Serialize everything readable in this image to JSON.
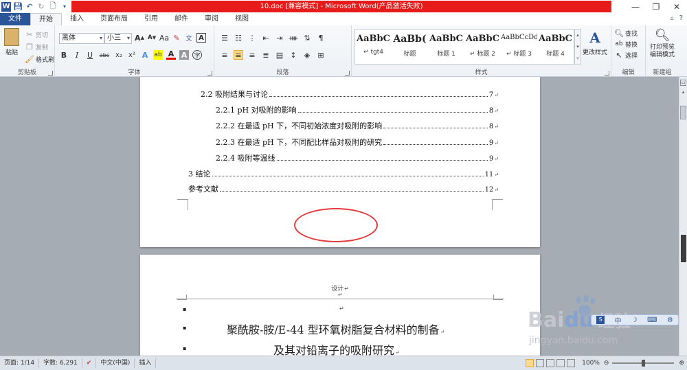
{
  "app": {
    "title": "10.doc [兼容模式] - Microsoft Word(产品激活失败)",
    "accent": "#2a5699",
    "title_bar_color": "#e81b1b"
  },
  "qat": {
    "icons": [
      "word-logo-icon",
      "save-icon",
      "undo-icon",
      "redo-icon",
      "print-preview-icon",
      "customize-qat-icon"
    ]
  },
  "window_controls": {
    "icons": [
      "minimize-icon",
      "restore-icon",
      "close-icon"
    ],
    "glyphs": [
      "—",
      "❐",
      "✕"
    ]
  },
  "tabs": [
    {
      "label": "文件"
    },
    {
      "label": "开始"
    },
    {
      "label": "插入"
    },
    {
      "label": "页面布局"
    },
    {
      "label": "引用"
    },
    {
      "label": "邮件"
    },
    {
      "label": "审阅"
    },
    {
      "label": "视图"
    }
  ],
  "ribbon": {
    "clipboard": {
      "label": "剪贴板",
      "paste": "粘贴",
      "cut": "剪切",
      "copy": "复制",
      "format_painter": "格式刷"
    },
    "font": {
      "label": "字体",
      "font_name": "黑体",
      "font_size": "小三",
      "bold": "B",
      "italic": "I",
      "underline": "U",
      "strike": "abc",
      "subscript": "x₂",
      "superscript": "x²",
      "grow": "A",
      "shrink": "A",
      "change_case": "Aa",
      "clear": "A",
      "phonetic": "wén",
      "char_border": "A",
      "highlight": "ab",
      "font_color": "A",
      "char_shading": "A",
      "enclosed": "字"
    },
    "paragraph": {
      "label": "段落"
    },
    "styles": {
      "label": "样式",
      "items": [
        {
          "sample": "AaBbC",
          "name": "↵ tgt4"
        },
        {
          "sample": "AaBb(",
          "name": "标题"
        },
        {
          "sample": "AaBbC",
          "name": "标题 1"
        },
        {
          "sample": "AaBbC",
          "name": "↵ 标题 2"
        },
        {
          "sample": "AaBbCcDd",
          "name": "↵ 标题 3"
        },
        {
          "sample": "AaBbC",
          "name": "标题 4"
        }
      ],
      "change_styles": "更改样式"
    },
    "editing": {
      "label": "编辑",
      "find": "查找",
      "replace": "替换",
      "select": "选择"
    },
    "new_group": {
      "label": "新建组",
      "print_preview": "打印预览编辑模式"
    }
  },
  "document": {
    "toc": [
      {
        "text": "2.2  吸附结果与讨论",
        "page": "7"
      },
      {
        "text": "2.2.1 pH 对吸附的影响",
        "page": "8"
      },
      {
        "text": "2.2.2  在最适 pH 下，不同初始浓度对吸附的影响",
        "page": "8"
      },
      {
        "text": "2.2.3  在最适 pH 下，不同配比样品对吸附的研究",
        "page": "9"
      },
      {
        "text": "2.2.4  吸附等温线",
        "page": "9"
      },
      {
        "text": "3  结论",
        "page": "11"
      },
      {
        "text": "参考文献",
        "page": "12"
      }
    ],
    "page2_header": "设计",
    "title_line1": "聚酰胺-胺/E-44 型环氧树脂复合材料的制备",
    "title_line2": "及其对铅离子的吸附研究",
    "paragraph_mark": "↵",
    "bullet": "▪",
    "annotation_color": "#e23b3b"
  },
  "statusbar": {
    "page": "页面: 1/14",
    "words": "字数: 6,291",
    "language": "中文(中国)",
    "mode": "插入",
    "zoom": "100%"
  },
  "watermark": {
    "brand": "Bai",
    "brand2": "du",
    "cn": "经验",
    "url": "jingyan.baidu.com"
  }
}
